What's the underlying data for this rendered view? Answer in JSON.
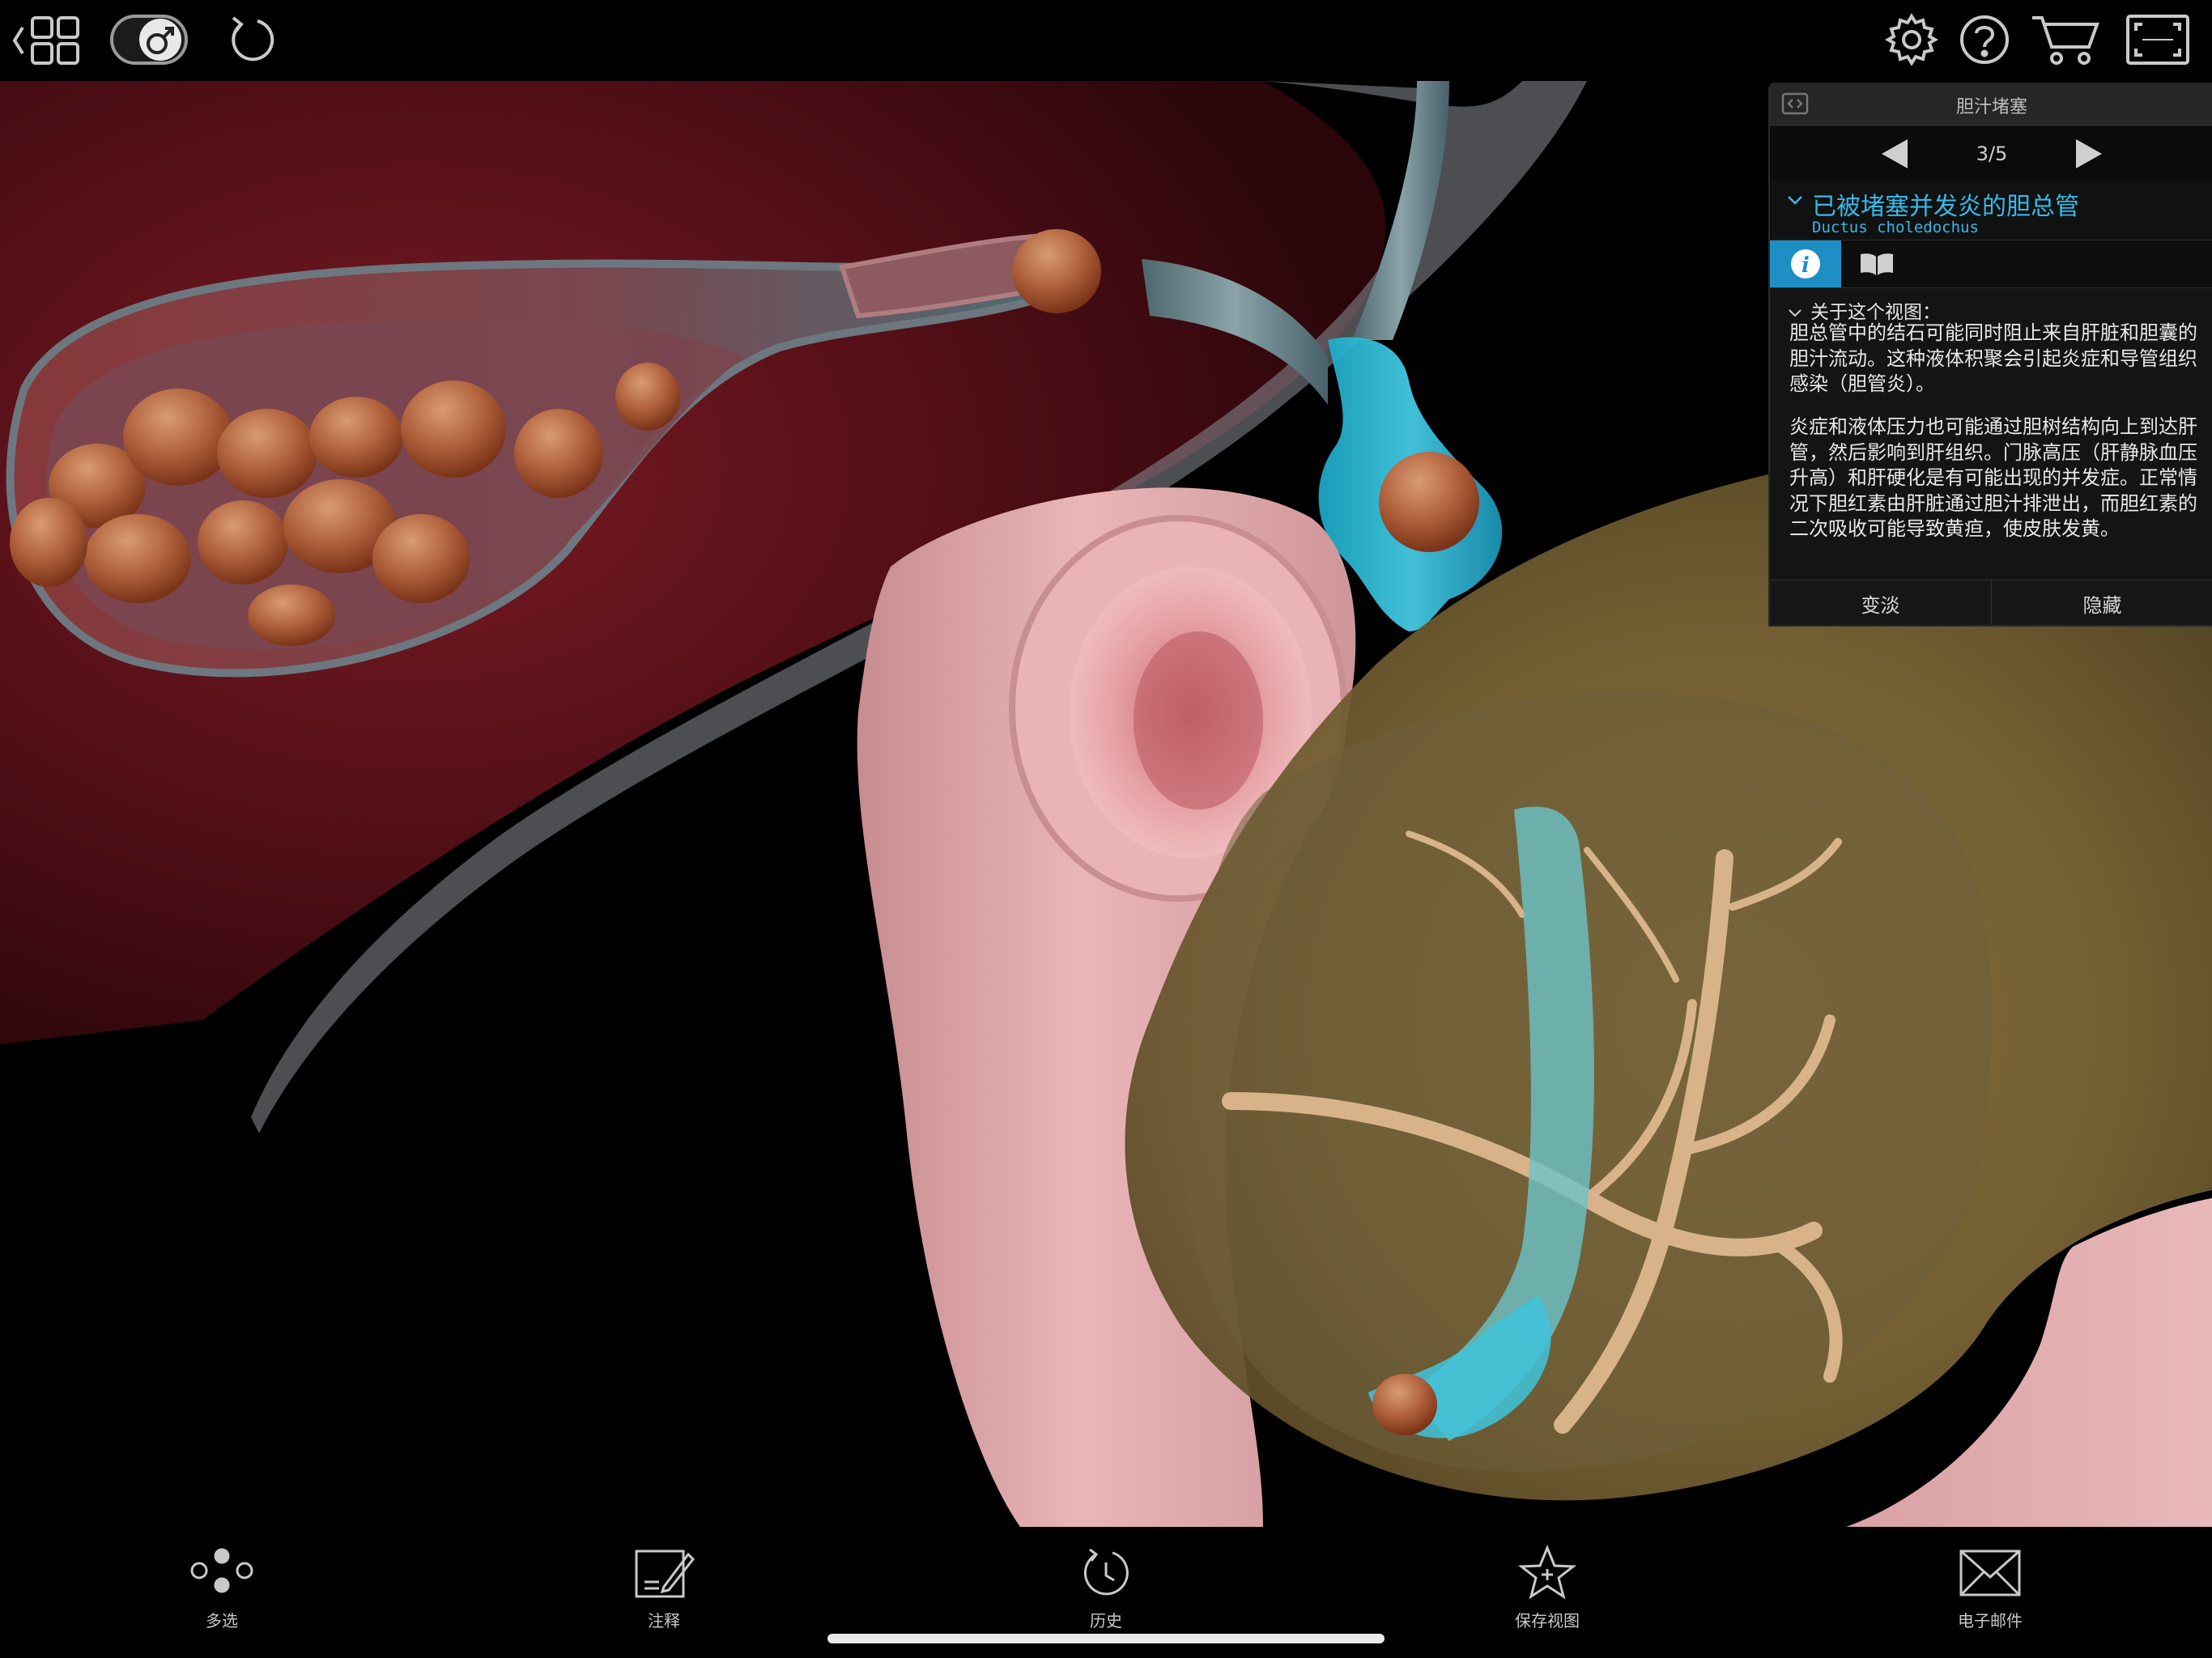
{
  "toolbar": {
    "icons": [
      "back-grid-icon",
      "gender-male-toggle-icon",
      "reset-rotate-icon",
      "gear-icon",
      "help-question-icon",
      "cart-icon",
      "fullscreen-icon"
    ]
  },
  "panel": {
    "title": "胆汁堵塞",
    "page_indicator": "3/5",
    "structure_name": "已被堵塞并发炎的胆总管",
    "structure_latin": "Ductus choledochus",
    "about_title": "关于这个视图：",
    "description_1": "胆总管中的结石可能同时阻止来自肝脏和胆囊的胆汁流动。这种液体积聚会引起炎症和导管组织感染（胆管炎）。",
    "description_2": "炎症和液体压力也可能通过胆树结构向上到达肝管，然后影响到肝组织。门脉高压（肝静脉血压升高）和肝硬化是有可能出现的并发症。正常情况下胆红素由肝脏通过胆汁排泄出，而胆红素的二次吸收可能导致黄疸，使皮肤发黄。",
    "fade_label": "变淡",
    "hide_label": "隐藏",
    "accent_color": "#35b9e8"
  },
  "bottom_bar": {
    "multi_select_label": "多选",
    "annotate_label": "注释",
    "history_label": "历史",
    "save_view_label": "保存视图",
    "email_label": "电子邮件"
  }
}
